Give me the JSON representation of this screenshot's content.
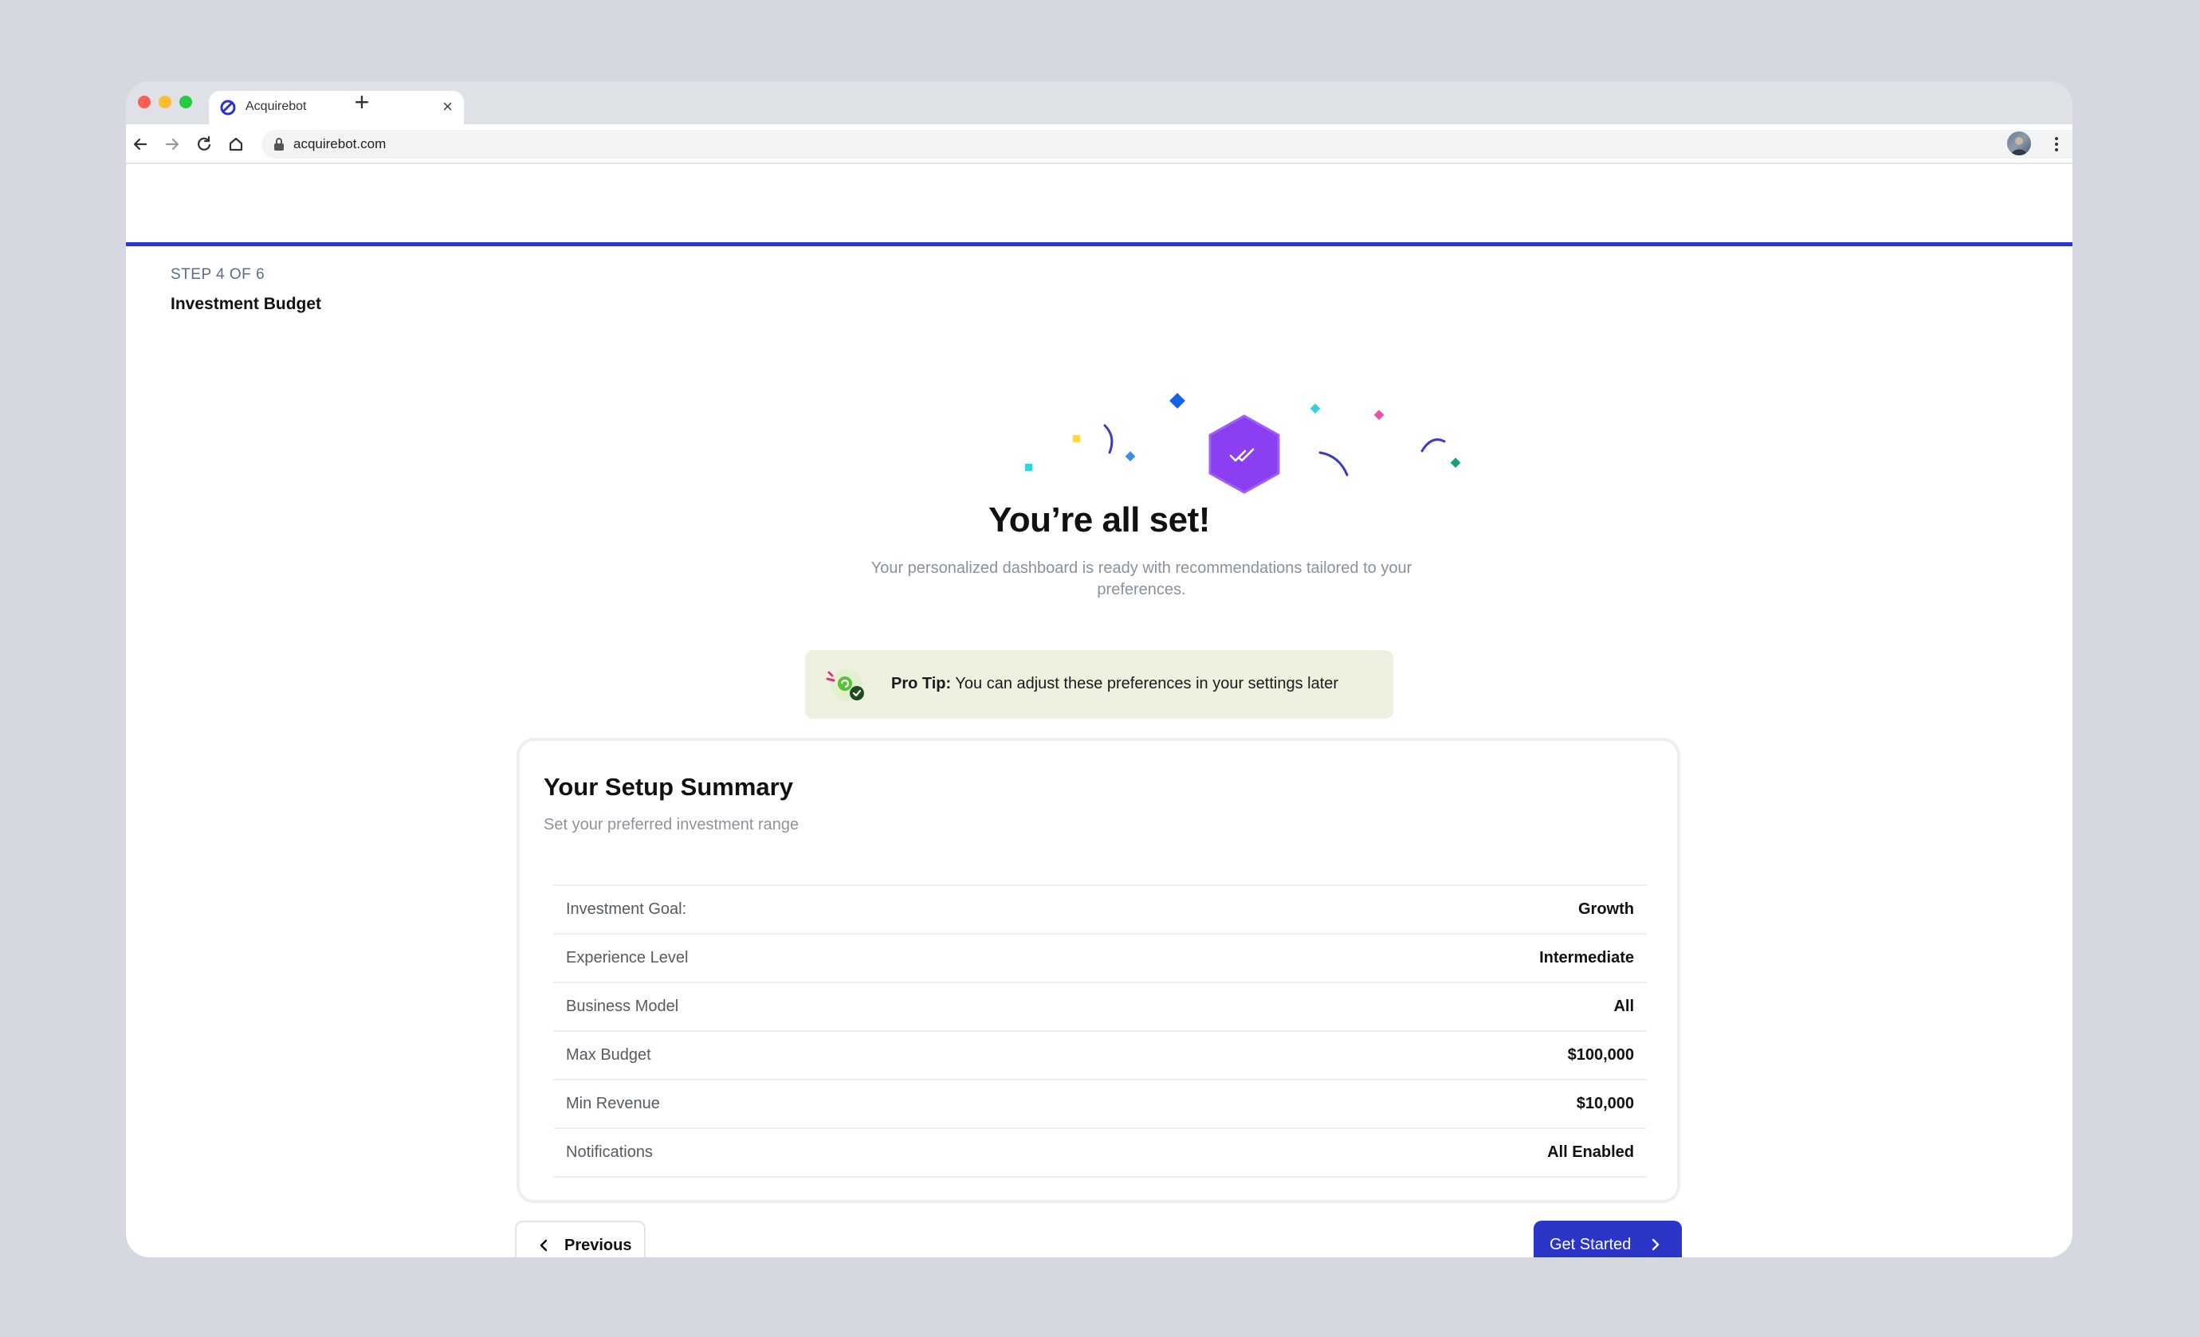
{
  "browser": {
    "tab_title": "Acquirebot",
    "new_tab_symbol": "+",
    "close_symbol": "×",
    "url": "acquirebot.com"
  },
  "stepper": {
    "kicker": "STEP 4 OF 6",
    "title": "Investment Budget"
  },
  "hero": {
    "headline": "You’re all set!",
    "subtext": "Your personalized dashboard is ready with recommendations tailored to your preferences."
  },
  "tip": {
    "label": "Pro Tip:",
    "text": " You can adjust these preferences in your settings later"
  },
  "summary": {
    "title": "Your Setup Summary",
    "subtitle": "Set your preferred investment range",
    "rows": [
      {
        "label": "Investment Goal:",
        "value": "Growth"
      },
      {
        "label": "Experience Level",
        "value": "Intermediate"
      },
      {
        "label": "Business Model",
        "value": "All"
      },
      {
        "label": "Max Budget",
        "value": "$100,000"
      },
      {
        "label": "Min Revenue",
        "value": "$10,000"
      },
      {
        "label": "Notifications",
        "value": "All Enabled"
      }
    ]
  },
  "actions": {
    "previous_label": "Previous",
    "get_started_label": "Get Started"
  },
  "colors": {
    "accent": "#2b36c9",
    "badge_purple": "#8b3ff0",
    "tip_background": "#eef1e0"
  },
  "icons": {
    "favicon": "acquirebot-logo-icon",
    "back": "arrow-left-icon",
    "forward": "arrow-right-icon",
    "reload": "reload-icon",
    "home": "home-icon",
    "lock": "lock-icon",
    "bookmark": "star-icon",
    "menu": "kebab-menu-icon",
    "success": "double-check-hexagon-icon",
    "tip": "sparkle-check-icon",
    "prev": "chevron-left-icon",
    "next": "chevron-right-icon"
  }
}
